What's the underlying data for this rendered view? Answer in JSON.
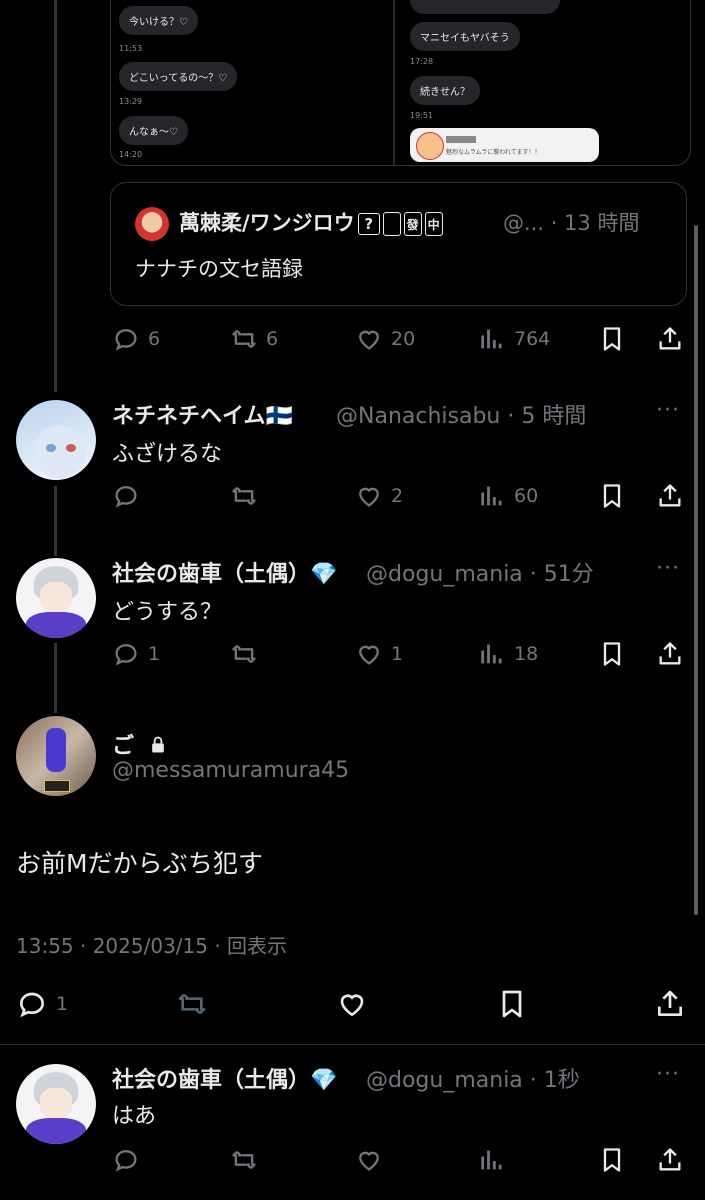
{
  "quoted_images": {
    "left_chat": [
      {
        "text": "今いける？♡",
        "time": "11:53"
      },
      {
        "text": "どこいってるの〜？♡",
        "time": "13:29"
      },
      {
        "text": "んなぁ〜♡",
        "time": "14:20"
      }
    ],
    "right_chat": [
      {
        "text": "マニセイもヤバそう",
        "time": "17:28"
      },
      {
        "text": "続きせん？",
        "time": "19:51"
      }
    ],
    "notification_text": "魅烈なムラムラに襲われてます！！"
  },
  "quote_card": {
    "author": "萬棘柔/ワンジロウ",
    "tiles": [
      "?",
      "",
      "發",
      "中"
    ],
    "handle_time": "@... · 13 時間",
    "text": "ナナチの文セ語録"
  },
  "quote_post_actions": {
    "replies": "6",
    "reposts": "6",
    "likes": "20",
    "views": "764"
  },
  "replies": [
    {
      "name": "ネチネチヘイム",
      "flag": "🇫🇮",
      "handle": "@Nanachisabu · 5 時間",
      "text": "ふざけるな",
      "replies": "",
      "reposts": "",
      "likes": "2",
      "views": "60"
    },
    {
      "name": "社会の歯車（土偶）",
      "flag": "💎",
      "handle": "@dogu_mania · 51分",
      "text": "どうする？",
      "replies": "1",
      "reposts": "",
      "likes": "1",
      "views": "18"
    }
  ],
  "main_post": {
    "name": "ご",
    "handle": "@messamuramura45",
    "text": "お前Mだからぶち犯す",
    "timestamp": "13:55 · 2025/03/15 · 回表示",
    "replies": "1"
  },
  "last_reply": {
    "name": "社会の歯車（土偶）",
    "flag": "💎",
    "handle": "@dogu_mania · 1秒",
    "text": "はあ"
  }
}
